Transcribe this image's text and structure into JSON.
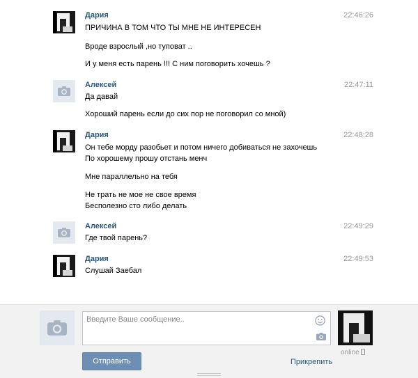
{
  "messages": [
    {
      "author": "Дария",
      "time": "22:46:26",
      "lines": [
        "ПРИЧИНА В ТОМ ЧТО ТЫ МНЕ НЕ ИНТЕРЕСЕН",
        "Вроде взрослый ,но туповат ..",
        "И у меня есть парень !!! С ним поговорить хочешь ?"
      ]
    },
    {
      "author": "Алексей",
      "time": "22:47:11",
      "lines": [
        "Да давай",
        "Хороший парень если до сих пор не поговорил со мной)"
      ]
    },
    {
      "author": "Дария",
      "time": "22:48:28",
      "lines": [
        "Он тебе морду разобьет и потом ничего добиваться не захочешь",
        "По хорошему прошу отстань менч",
        "Мне параллельно на тебя",
        "Не трать не мое не свое время",
        "Бесполезно сто либо делать"
      ]
    },
    {
      "author": "Алексей",
      "time": "22:49:29",
      "lines": [
        "Где твой парень?"
      ]
    },
    {
      "author": "Дария",
      "time": "22:49:53",
      "lines": [
        "Слушай Заебал"
      ]
    }
  ],
  "composer": {
    "placeholder": "Введите Ваше сообщение..",
    "send_label": "Отправить",
    "attach_label": "Прикрепить",
    "online_label": "online"
  },
  "icons": {
    "camera": "camera-icon",
    "smile": "smile-icon",
    "phone": "mobile-phone-icon"
  },
  "colors": {
    "author": "#2b587a",
    "time": "#999999",
    "send_button": "#6d8fb3",
    "composer_bg": "#f2f2f2",
    "camera_placeholder_bg": "#e4e9ef"
  }
}
